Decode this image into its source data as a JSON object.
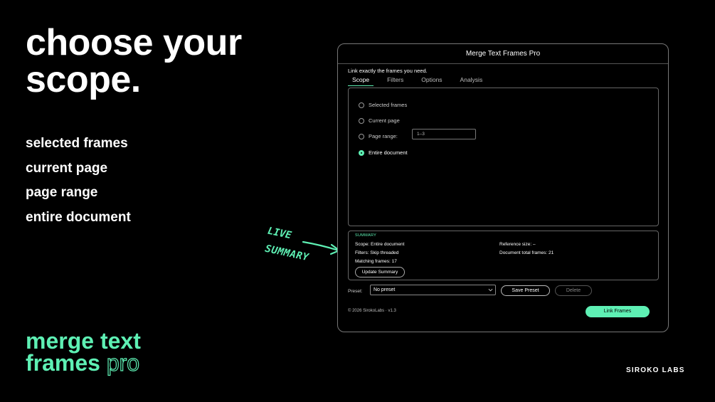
{
  "headline": {
    "line1": "choose your",
    "line2": "scope."
  },
  "features": [
    "selected frames",
    "current page",
    "page range",
    "entire document"
  ],
  "brand": {
    "line1": "merge text",
    "line2_word": "frames",
    "line2_accent": "pro"
  },
  "company": "SIROKO LABS",
  "annotation": {
    "line1": "LIVE",
    "line2": "SUMMARY"
  },
  "window": {
    "title": "Merge Text Frames Pro",
    "subtitle": "Link exactly the frames you need.",
    "tabs": [
      {
        "label": "Scope",
        "active": true
      },
      {
        "label": "Filters",
        "active": false
      },
      {
        "label": "Options",
        "active": false
      },
      {
        "label": "Analysis",
        "active": false
      }
    ],
    "scope_options": [
      {
        "label": "Selected frames",
        "checked": false
      },
      {
        "label": "Current page",
        "checked": false
      },
      {
        "label": "Page range:",
        "checked": false
      },
      {
        "label": "Entire document",
        "checked": true
      }
    ],
    "page_range_value": "1–3",
    "summary": {
      "label": "SUMMARY",
      "scope": "Scope: Entire document",
      "filters": "Filters: Skip threaded",
      "matching": "Matching frames: 17",
      "reference": "Reference size: –",
      "total": "Document total frames: 21",
      "update_button": "Update Summary"
    },
    "preset": {
      "label": "Preset:",
      "selected": "No preset",
      "save_button": "Save Preset",
      "delete_button": "Delete"
    },
    "copyright": "© 2026 SirokoLabs · v1.3",
    "link_button": "Link Frames"
  },
  "colors": {
    "accent": "#5ef0b4",
    "background": "#000000",
    "border": "#777777"
  },
  "icons": {
    "dropdown": "chevron-down-icon",
    "annotation_arrow": "arrow-icon"
  }
}
